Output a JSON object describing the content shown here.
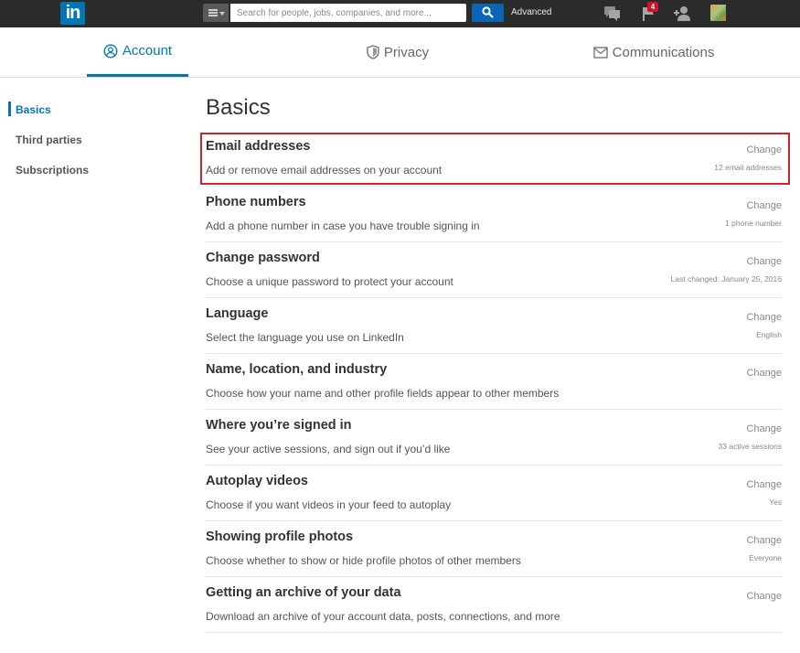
{
  "topbar": {
    "logo_text": "in",
    "search": {
      "placeholder": "Search for people, jobs, companies, and more..."
    },
    "advanced_label": "Advanced",
    "notification_count": "4",
    "icons": [
      "menu-icon",
      "search-icon",
      "messages-icon",
      "flag-icon",
      "add-connection-icon",
      "avatar"
    ]
  },
  "tabs": [
    {
      "label": "Account",
      "icon": "user-circle-icon",
      "active": true
    },
    {
      "label": "Privacy",
      "icon": "shield-icon",
      "active": false
    },
    {
      "label": "Communications",
      "icon": "envelope-icon",
      "active": false
    }
  ],
  "sidenav": {
    "items": [
      {
        "label": "Basics",
        "active": true
      },
      {
        "label": "Third parties",
        "active": false
      },
      {
        "label": "Subscriptions",
        "active": false
      }
    ]
  },
  "main": {
    "title": "Basics",
    "highlighted_row": 0,
    "rows": [
      {
        "title": "Email addresses",
        "description": "Add or remove email addresses on your account",
        "action": "Change",
        "value": "12 email addresses"
      },
      {
        "title": "Phone numbers",
        "description": "Add a phone number in case you have trouble signing in",
        "action": "Change",
        "value": "1 phone number"
      },
      {
        "title": "Change password",
        "description": "Choose a unique password to protect your account",
        "action": "Change",
        "value": "Last changed: January 25, 2016"
      },
      {
        "title": "Language",
        "description": "Select the language you use on LinkedIn",
        "action": "Change",
        "value": "English"
      },
      {
        "title": "Name, location, and industry",
        "description": "Choose how your name and other profile fields appear to other members",
        "action": "Change",
        "value": ""
      },
      {
        "title": "Where you’re signed in",
        "description": "See your active sessions, and sign out if you’d like",
        "action": "Change",
        "value": "33 active sessions"
      },
      {
        "title": "Autoplay videos",
        "description": "Choose if you want videos in your feed to autoplay",
        "action": "Change",
        "value": "Yes"
      },
      {
        "title": "Showing profile photos",
        "description": "Choose whether to show or hide profile photos of other members",
        "action": "Change",
        "value": "Everyone"
      },
      {
        "title": "Getting an archive of your data",
        "description": "Download an archive of your account data, posts, connections, and more",
        "action": "Change",
        "value": ""
      }
    ]
  },
  "colors": {
    "brand": "#0077b5",
    "topbar": "#2b2b2b",
    "highlight": "#d2202f",
    "badge": "#d11124"
  }
}
